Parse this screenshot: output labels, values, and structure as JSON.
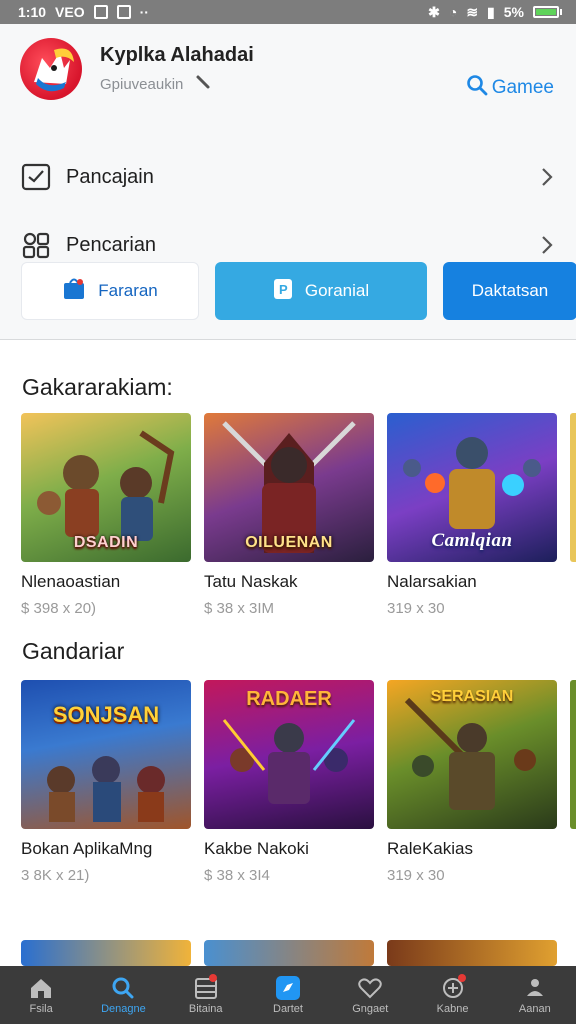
{
  "status_bar": {
    "time": "1:10",
    "carrier": "VEO",
    "battery_text": "5%",
    "battery_level": 0.9
  },
  "profile": {
    "name": "Kyplka Alahadai",
    "subtitle": "Gpiuveaukin"
  },
  "header_search": {
    "label": "Gamee",
    "icon": "search-icon"
  },
  "menu": [
    {
      "label": "Pancajain",
      "icon": "checkbox-icon"
    },
    {
      "label": "Pencarian",
      "icon": "shapes-icon"
    }
  ],
  "actions": [
    {
      "label": "Fararan",
      "icon": "store-icon"
    },
    {
      "label": "Goranial",
      "icon": "badge-icon"
    },
    {
      "label": "Daktatsan"
    }
  ],
  "sections": [
    {
      "title": "Gakararakiam:",
      "items": [
        {
          "name": "Nlenaoastian",
          "price": "$ 398 x 20)",
          "art_text": "DSADIN"
        },
        {
          "name": "Tatu Naskak",
          "price": "$ 38 x 3IM",
          "art_text": "OILUENAN"
        },
        {
          "name": "Nalarsakian",
          "price": "319 x 30",
          "art_text": "Camlqian"
        }
      ]
    },
    {
      "title": "Gandariar",
      "items": [
        {
          "name": "Bokan AplikaMng",
          "price": "3 8K x 21)",
          "art_text": "SONJSAN"
        },
        {
          "name": "Kakbe Nakoki",
          "price": "$ 38 x 3I4",
          "art_text": "RADAER"
        },
        {
          "name": "RaleKakias",
          "price": "319 x 30",
          "art_text": "SERASIAN"
        }
      ]
    }
  ],
  "tabs": [
    {
      "label": "Fsila",
      "icon": "home-icon",
      "active": false
    },
    {
      "label": "Denagne",
      "icon": "search-icon",
      "active": true
    },
    {
      "label": "Bitaina",
      "icon": "grid-icon",
      "active": false
    },
    {
      "label": "Dartet",
      "icon": "compass-icon",
      "active": false
    },
    {
      "label": "Gngaet",
      "icon": "heart-icon",
      "active": false
    },
    {
      "label": "Kabne",
      "icon": "plus-circle-icon",
      "active": false
    },
    {
      "label": "Aanan",
      "icon": "person-icon",
      "active": false
    }
  ],
  "colors": {
    "accent": "#1e88e5",
    "tab_active": "#3ea6f2",
    "tabbar_bg": "#3b3b3b",
    "status_bg": "#7d7d7d"
  }
}
